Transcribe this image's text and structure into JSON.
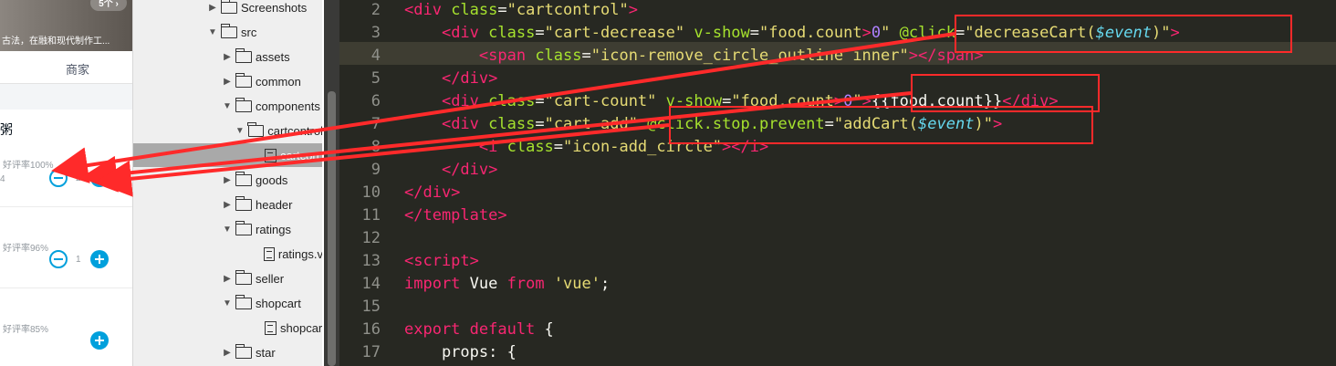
{
  "app": {
    "banner_badge": "5个 ›",
    "banner_text": "古法，在融和现代制作工...",
    "tab_label": "商家",
    "section_char": "粥",
    "foods": [
      {
        "rating": "好评率100%",
        "price_fragment": "4",
        "count": "2",
        "show_minus": true
      },
      {
        "rating": "好评率96%",
        "price_fragment": "",
        "count": "1",
        "show_minus": true
      },
      {
        "rating": "好评率85%",
        "price_fragment": "",
        "count": "",
        "show_minus": false
      }
    ]
  },
  "tree": {
    "items": [
      {
        "label": "Screenshots",
        "type": "folder",
        "caret": "▶"
      },
      {
        "label": "src",
        "type": "folder-open",
        "caret": "▼"
      },
      {
        "label": "assets",
        "type": "folder",
        "caret": "▶"
      },
      {
        "label": "common",
        "type": "folder",
        "caret": "▶"
      },
      {
        "label": "components",
        "type": "folder-open",
        "caret": "▼"
      },
      {
        "label": "cartcontrol",
        "type": "folder-open",
        "caret": "▼"
      },
      {
        "label": "cartcon",
        "type": "file",
        "caret": ""
      },
      {
        "label": "goods",
        "type": "folder",
        "caret": "▶"
      },
      {
        "label": "header",
        "type": "folder",
        "caret": "▶"
      },
      {
        "label": "ratings",
        "type": "folder-open",
        "caret": "▼"
      },
      {
        "label": "ratings.v",
        "type": "file",
        "caret": ""
      },
      {
        "label": "seller",
        "type": "folder",
        "caret": "▶"
      },
      {
        "label": "shopcart",
        "type": "folder-open",
        "caret": "▼"
      },
      {
        "label": "shopcar",
        "type": "file",
        "caret": ""
      },
      {
        "label": "star",
        "type": "folder",
        "caret": "▶"
      }
    ]
  },
  "editor": {
    "line_numbers": [
      "2",
      "3",
      "4",
      "5",
      "6",
      "7",
      "8",
      "9",
      "10",
      "11",
      "12",
      "13",
      "14",
      "15",
      "16",
      "17"
    ],
    "lines": [
      [
        [
          "t",
          "<div "
        ],
        [
          "a",
          "class"
        ],
        [
          "p",
          "="
        ],
        [
          "s",
          "\"cartcontrol\""
        ],
        [
          "t",
          ">"
        ]
      ],
      [
        [
          "p",
          "    "
        ],
        [
          "t",
          "<div "
        ],
        [
          "a",
          "class"
        ],
        [
          "p",
          "="
        ],
        [
          "s",
          "\"cart-decrease\""
        ],
        [
          "p",
          " "
        ],
        [
          "a",
          "v-show"
        ],
        [
          "p",
          "="
        ],
        [
          "s",
          "\"food.count"
        ],
        [
          "t",
          ">"
        ],
        [
          "n",
          "0"
        ],
        [
          "s",
          "\""
        ],
        [
          "p",
          " "
        ],
        [
          "a",
          "@click"
        ],
        [
          "p",
          "="
        ],
        [
          "s",
          "\"decreaseCart("
        ],
        [
          "v",
          "$event"
        ],
        [
          "s",
          ")\""
        ],
        [
          "t",
          ">"
        ]
      ],
      [
        [
          "p",
          "        "
        ],
        [
          "t",
          "<span "
        ],
        [
          "a",
          "class"
        ],
        [
          "p",
          "="
        ],
        [
          "s",
          "\"icon-remove_circle_outline inner\""
        ],
        [
          "t",
          "></span>"
        ]
      ],
      [
        [
          "p",
          "    "
        ],
        [
          "t",
          "</div>"
        ]
      ],
      [
        [
          "p",
          "    "
        ],
        [
          "t",
          "<div "
        ],
        [
          "a",
          "class"
        ],
        [
          "p",
          "="
        ],
        [
          "s",
          "\"cart-count\""
        ],
        [
          "p",
          " "
        ],
        [
          "a",
          "v-show"
        ],
        [
          "p",
          "="
        ],
        [
          "s",
          "\"food.count"
        ],
        [
          "t",
          ">"
        ],
        [
          "n",
          "0"
        ],
        [
          "s",
          "\""
        ],
        [
          "t",
          ">"
        ],
        [
          "p",
          "{{food.count}}"
        ],
        [
          "t",
          "</div>"
        ]
      ],
      [
        [
          "p",
          "    "
        ],
        [
          "t",
          "<div "
        ],
        [
          "a",
          "class"
        ],
        [
          "p",
          "="
        ],
        [
          "s",
          "\"cart-add\""
        ],
        [
          "p",
          " "
        ],
        [
          "a",
          "@click.stop.prevent"
        ],
        [
          "p",
          "="
        ],
        [
          "s",
          "\"addCart("
        ],
        [
          "v",
          "$event"
        ],
        [
          "s",
          ")\""
        ],
        [
          "t",
          ">"
        ]
      ],
      [
        [
          "p",
          "        "
        ],
        [
          "t",
          "<i "
        ],
        [
          "a",
          "class"
        ],
        [
          "p",
          "="
        ],
        [
          "s",
          "\"icon-add_circle\""
        ],
        [
          "t",
          "></i>"
        ]
      ],
      [
        [
          "p",
          "    "
        ],
        [
          "t",
          "</div>"
        ]
      ],
      [
        [
          "t",
          "</div>"
        ]
      ],
      [
        [
          "t",
          "</template>"
        ]
      ],
      [
        [
          "p",
          ""
        ]
      ],
      [
        [
          "t",
          "<script>"
        ]
      ],
      [
        [
          "k",
          "import"
        ],
        [
          "p",
          " Vue "
        ],
        [
          "k",
          "from"
        ],
        [
          "p",
          " "
        ],
        [
          "s",
          "'vue'"
        ],
        [
          "p",
          ";"
        ]
      ],
      [
        [
          "p",
          ""
        ]
      ],
      [
        [
          "k",
          "export default"
        ],
        [
          "p",
          " {"
        ]
      ],
      [
        [
          "p",
          "    props: {"
        ]
      ]
    ]
  },
  "annotation_color": "#ff2a2a",
  "accent_color": "#00a0dc"
}
